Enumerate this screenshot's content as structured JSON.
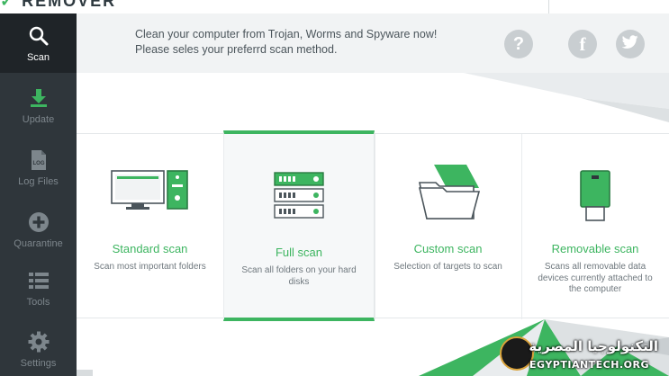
{
  "app": {
    "brand_text": "REMOVER",
    "accent_color": "#3db560",
    "sidebar_color": "#2f363b"
  },
  "sidebar": {
    "items": [
      {
        "label": "Scan",
        "icon": "search-icon",
        "active": true
      },
      {
        "label": "Update",
        "icon": "download-icon",
        "active": false
      },
      {
        "label": "Log Files",
        "icon": "log-file-icon",
        "active": false
      },
      {
        "label": "Quarantine",
        "icon": "plus-circle-icon",
        "active": false
      },
      {
        "label": "Tools",
        "icon": "tools-list-icon",
        "active": false
      },
      {
        "label": "Settings",
        "icon": "gear-icon",
        "active": false
      }
    ]
  },
  "header": {
    "line1": "Clean your computer from Trojan, Worms and Spyware now!",
    "line2": "Please seles your preferrd scan method.",
    "help_label": "?",
    "facebook_label": "f",
    "twitter_icon": "twitter-icon"
  },
  "scan_options": [
    {
      "title": "Standard scan",
      "desc": "Scan most important folders",
      "icon": "desktop-computer-icon",
      "selected": false
    },
    {
      "title": "Full scan",
      "desc": "Scan all folders on your hard disks",
      "icon": "server-drives-icon",
      "selected": true
    },
    {
      "title": "Custom scan",
      "desc": "Selection of targets to scan",
      "icon": "open-folder-icon",
      "selected": false
    },
    {
      "title": "Removable scan",
      "desc": "Scans all removable data devices currently attached to the computer",
      "icon": "usb-drive-icon",
      "selected": false
    }
  ],
  "watermark": {
    "arabic_text": "التكنولوجيا المصرية",
    "site_text": "EGYPTIANTECH.ORG",
    "seal_icon": "egyptiantech-seal-icon"
  }
}
